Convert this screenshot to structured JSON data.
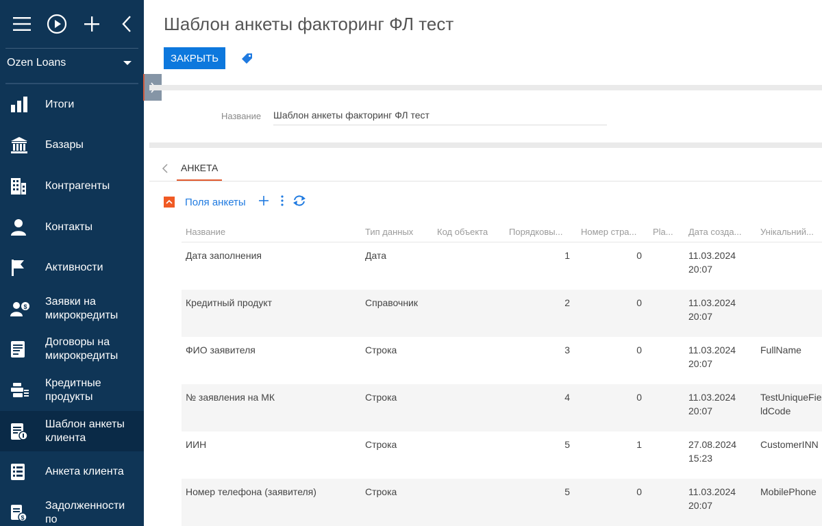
{
  "sidebar": {
    "workspace": "Ozen Loans",
    "items": [
      {
        "label": "Итоги",
        "icon": "bar-chart-icon"
      },
      {
        "label": "Базары",
        "icon": "bank-icon"
      },
      {
        "label": "Контрагенты",
        "icon": "building-icon"
      },
      {
        "label": "Контакты",
        "icon": "person-icon"
      },
      {
        "label": "Активности",
        "icon": "flag-icon"
      },
      {
        "label": "Заявки на\nмикрокредиты",
        "icon": "loan-request-icon"
      },
      {
        "label": "Договоры на\nмикрокредиты",
        "icon": "contract-icon"
      },
      {
        "label": "Кредитные\nпродукты",
        "icon": "credit-products-icon"
      },
      {
        "label": "Шаблон анкеты\nклиента",
        "icon": "form-template-icon"
      },
      {
        "label": "Анкета клиента",
        "icon": "questionnaire-icon"
      },
      {
        "label": "Задолженности\nпо",
        "icon": "debt-icon"
      }
    ],
    "active_index": 8
  },
  "header": {
    "title": "Шаблон анкеты факторинг ФЛ тест",
    "close_label": "ЗАКРЫТЬ"
  },
  "form": {
    "name_label": "Название",
    "name_value": "Шаблон анкеты факторинг ФЛ тест"
  },
  "tabs": {
    "active_label": "АНКЕТА"
  },
  "detail": {
    "title": "Поля анкеты",
    "columns": [
      "Название",
      "Тип данных",
      "Код объекта",
      "Порядковы...",
      "Номер стра...",
      "Pla...",
      "Дата созда...",
      "Унікальний..."
    ],
    "rows": [
      {
        "name": "Дата заполнения",
        "type": "Дата",
        "code": "",
        "order": "1",
        "page": "0",
        "pla": "",
        "date": "11.03.2024\n20:07",
        "unique": ""
      },
      {
        "name": "Кредитный продукт",
        "type": "Справочник",
        "code": "",
        "order": "2",
        "page": "0",
        "pla": "",
        "date": "11.03.2024\n20:07",
        "unique": ""
      },
      {
        "name": "ФИО заявителя",
        "type": "Строка",
        "code": "",
        "order": "3",
        "page": "0",
        "pla": "",
        "date": "11.03.2024\n20:07",
        "unique": "FullName"
      },
      {
        "name": "№ заявления на МК",
        "type": "Строка",
        "code": "",
        "order": "4",
        "page": "0",
        "pla": "",
        "date": "11.03.2024\n20:07",
        "unique": "TestUniqueFieldCode"
      },
      {
        "name": "ИИН",
        "type": "Строка",
        "code": "",
        "order": "5",
        "page": "1",
        "pla": "",
        "date": "27.08.2024\n15:23",
        "unique": "CustomerINN"
      },
      {
        "name": "Номер телефона (заявителя)",
        "type": "Строка",
        "code": "",
        "order": "5",
        "page": "0",
        "pla": "",
        "date": "11.03.2024\n20:07",
        "unique": "MobilePhone"
      }
    ]
  },
  "colors": {
    "sidebar_bg": "#0f3556",
    "primary_button": "#0d78dd",
    "accent_orange": "#f05a24",
    "link_blue": "#1f7ae0"
  }
}
